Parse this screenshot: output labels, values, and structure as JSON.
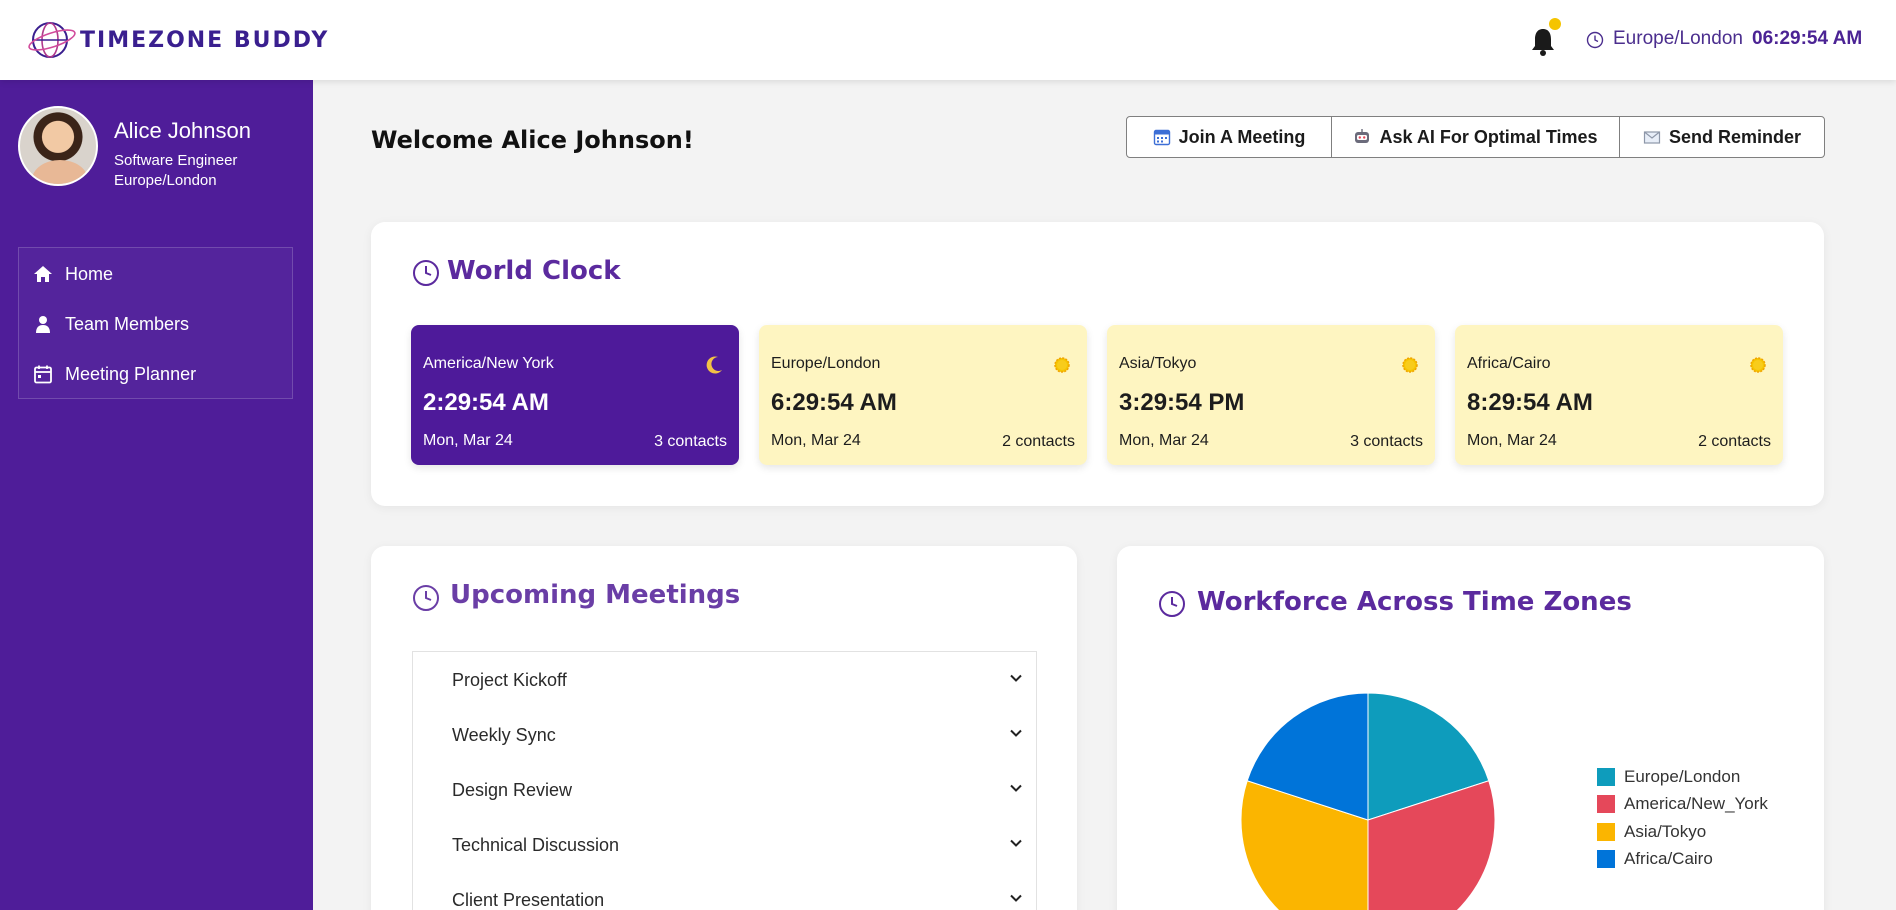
{
  "header": {
    "brand": "TIMEZONE BUDDY",
    "current_timezone": "Europe/London",
    "current_time": "06:29:54 AM",
    "icons": {
      "bell": "bell-icon",
      "clock": "clock-icon"
    },
    "notification_color": "#f5c400"
  },
  "sidebar": {
    "user": {
      "name": "Alice Johnson",
      "role": "Software Engineer",
      "timezone": "Europe/London"
    },
    "items": [
      {
        "label": "Home",
        "icon": "home-icon"
      },
      {
        "label": "Team Members",
        "icon": "user-icon"
      },
      {
        "label": "Meeting Planner",
        "icon": "calendar-icon"
      }
    ],
    "background": "#4f1d99"
  },
  "main": {
    "welcome": "Welcome Alice Johnson!",
    "actions": [
      {
        "label": "Join A Meeting",
        "icon": "calendar-icon"
      },
      {
        "label": "Ask AI For Optimal Times",
        "icon": "robot-icon"
      },
      {
        "label": "Send Reminder",
        "icon": "envelope-icon"
      }
    ],
    "world_clock": {
      "title": "World Clock",
      "clocks": [
        {
          "zone": "America/New York",
          "time": "2:29:54 AM",
          "date": "Mon, Mar 24",
          "contacts": "3 contacts",
          "icon": "moon-icon"
        },
        {
          "zone": "Europe/London",
          "time": "6:29:54 AM",
          "date": "Mon, Mar 24",
          "contacts": "2 contacts",
          "icon": "sun-icon"
        },
        {
          "zone": "Asia/Tokyo",
          "time": "3:29:54 PM",
          "date": "Mon, Mar 24",
          "contacts": "3 contacts",
          "icon": "sun-icon"
        },
        {
          "zone": "Africa/Cairo",
          "time": "8:29:54 AM",
          "date": "Mon, Mar 24",
          "contacts": "2 contacts",
          "icon": "sun-icon"
        }
      ]
    },
    "meetings": {
      "title": "Upcoming Meetings",
      "items": [
        {
          "label": "Project Kickoff"
        },
        {
          "label": "Weekly Sync"
        },
        {
          "label": "Design Review"
        },
        {
          "label": "Technical Discussion"
        },
        {
          "label": "Client Presentation"
        }
      ]
    },
    "workforce": {
      "title": "Workforce Across Time Zones"
    }
  },
  "chart_data": {
    "type": "pie",
    "title": "Workforce Across Time Zones",
    "categories": [
      "Europe/London",
      "America/New_York",
      "Asia/Tokyo",
      "Africa/Cairo"
    ],
    "values": [
      2,
      3,
      3,
      2
    ],
    "colors": [
      "#0e9cbc",
      "#e5485a",
      "#fbb500",
      "#0074d9"
    ],
    "legend": "right"
  }
}
